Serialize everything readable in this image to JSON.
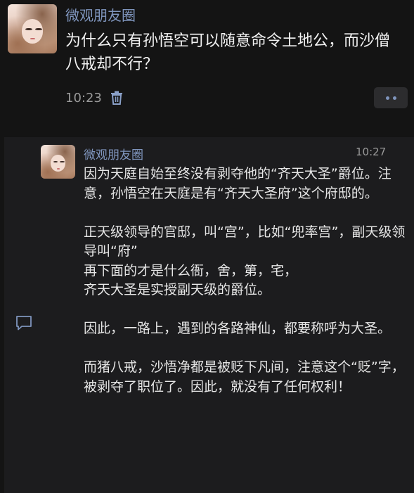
{
  "post": {
    "author": "微观朋友圈",
    "text": "为什么只有孙悟空可以随意命令土地公，而沙僧八戒却不行？",
    "time": "10:23"
  },
  "comment": {
    "author": "微观朋友圈",
    "time": "10:27",
    "text": "因为天庭自始至终没有剥夺他的“齐天大圣”爵位。注意，孙悟空在天庭是有“齐天大圣府”这个府邸的。\n\n正天级领导的官邸，叫“宫”，比如“兜率宫”，副天级领导叫“府”\n再下面的才是什么衙，舍，第，宅，\n齐天大圣是实授副天级的爵位。\n\n因此，一路上，遇到的各路神仙，都要称呼为大圣。\n\n而猪八戒，沙悟净都是被贬下凡间，注意这个“贬”字，被剥夺了职位了。因此，就没有了任何权利！"
  },
  "colors": {
    "background": "#141414",
    "panel": "#1c1c1e",
    "author_link": "#7f95bd",
    "muted": "#9a9a9a",
    "text": "#f2f2f2"
  },
  "icons": [
    "trash-icon",
    "more-dots-icon",
    "comment-icon"
  ]
}
